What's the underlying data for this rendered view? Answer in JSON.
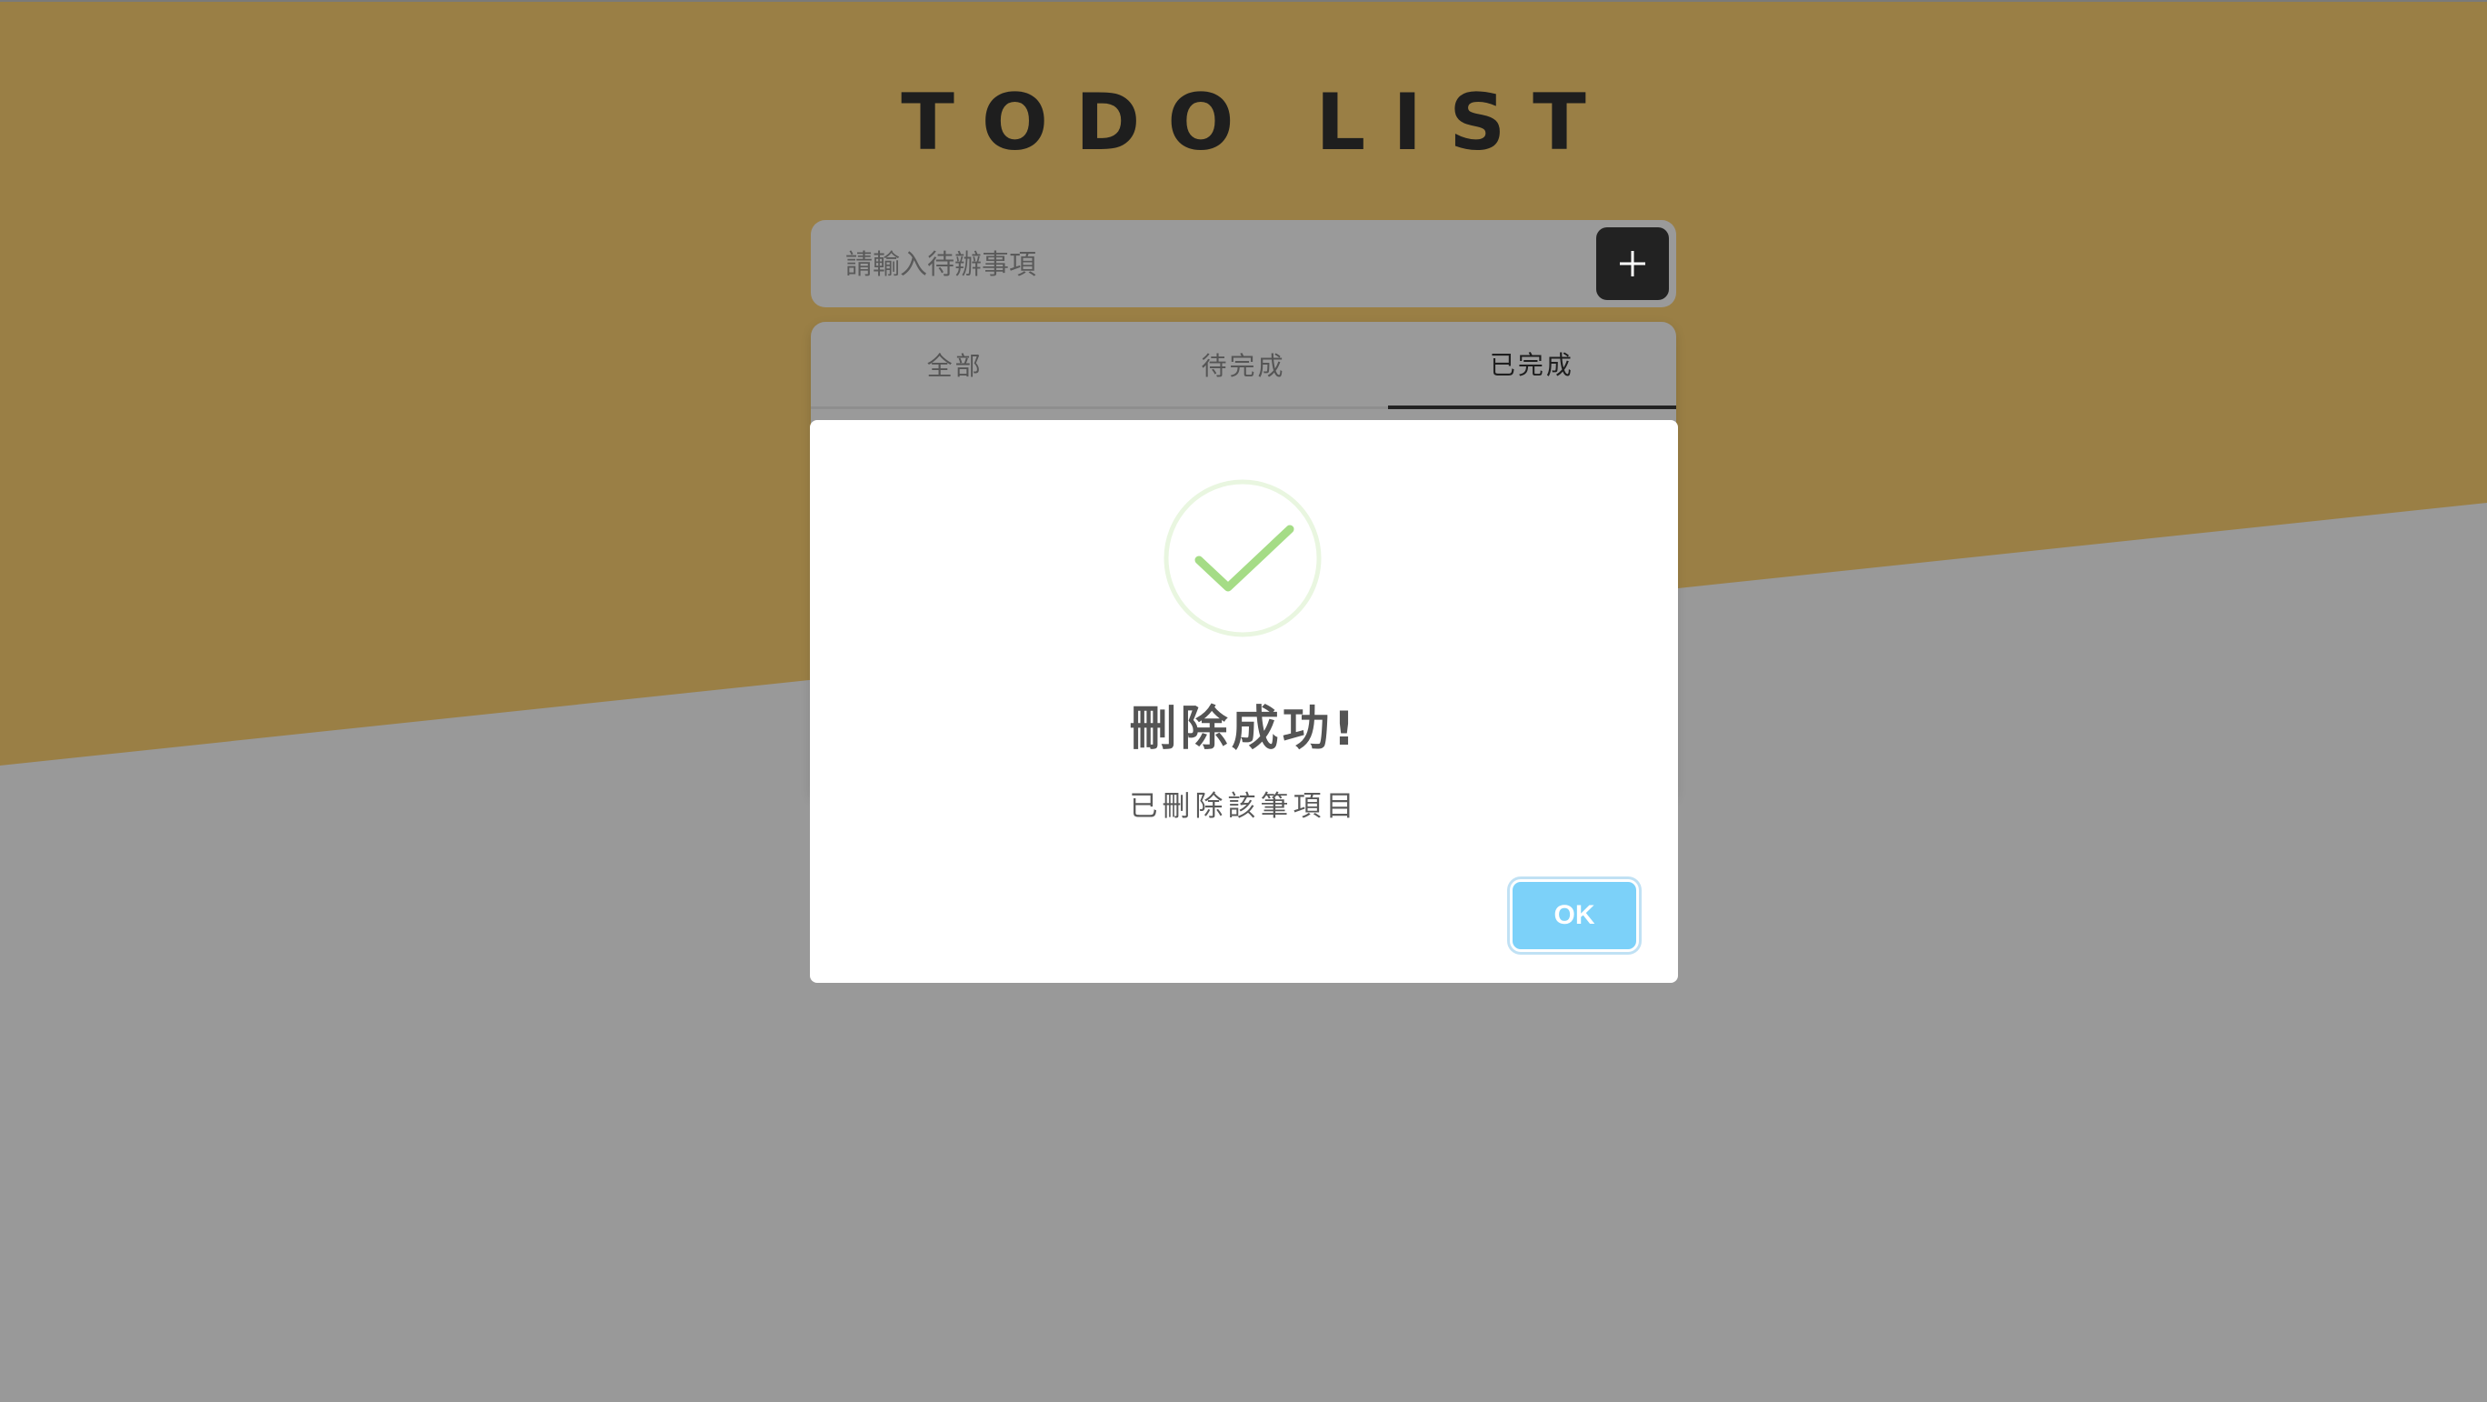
{
  "page": {
    "title": "TODO LIST"
  },
  "input": {
    "placeholder": "請輸入待辦事項",
    "value": "",
    "add_icon": "plus-icon"
  },
  "tabs": [
    {
      "label": "全部",
      "active": false
    },
    {
      "label": "待完成",
      "active": false
    },
    {
      "label": "已完成",
      "active": true
    }
  ],
  "modal": {
    "icon": "success-check-icon",
    "title": "刪除成功!",
    "text": "已刪除該筆項目",
    "ok_label": "OK"
  },
  "colors": {
    "background_gold": "#9a7f45",
    "background_gray": "#999999",
    "button_dark": "#222222",
    "ok_button": "#7cd1f9",
    "success_green": "#a5dc86"
  }
}
